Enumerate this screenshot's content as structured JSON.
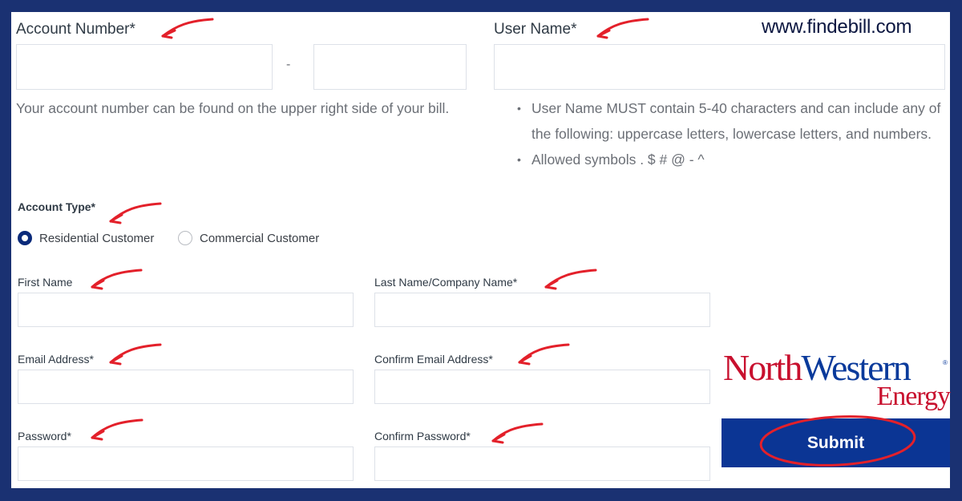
{
  "watermark": "www.findebill.com",
  "account_number": {
    "label": "Account Number*",
    "separator": "-",
    "help": "Your account number can be found on the upper right side of your bill.",
    "part1_value": "",
    "part2_value": ""
  },
  "user_name": {
    "label": "User Name*",
    "value": "",
    "rules": [
      "User Name MUST contain 5-40 characters and can include any of the following: uppercase letters, lowercase letters, and numbers.",
      "Allowed symbols . $ # @ - ^"
    ]
  },
  "account_type": {
    "label": "Account Type*",
    "options": [
      {
        "label": "Residential Customer",
        "selected": true
      },
      {
        "label": "Commercial Customer",
        "selected": false
      }
    ]
  },
  "fields": {
    "first_name": {
      "label": "First Name",
      "value": ""
    },
    "last_name": {
      "label": "Last Name/Company Name*",
      "value": ""
    },
    "email": {
      "label": "Email Address*",
      "value": ""
    },
    "confirm_email": {
      "label": "Confirm Email Address*",
      "value": ""
    },
    "password": {
      "label": "Password*",
      "value": ""
    },
    "confirm_password": {
      "label": "Confirm Password*",
      "value": ""
    }
  },
  "logo": {
    "north": "North",
    "western": "Western",
    "registered": "®",
    "energy": "Energy"
  },
  "submit_label": "Submit",
  "colors": {
    "frame": "#1a3172",
    "button": "#0b3594",
    "annotation": "#e3202a",
    "logo_red": "#c8102e",
    "logo_blue": "#0a3a9b"
  }
}
